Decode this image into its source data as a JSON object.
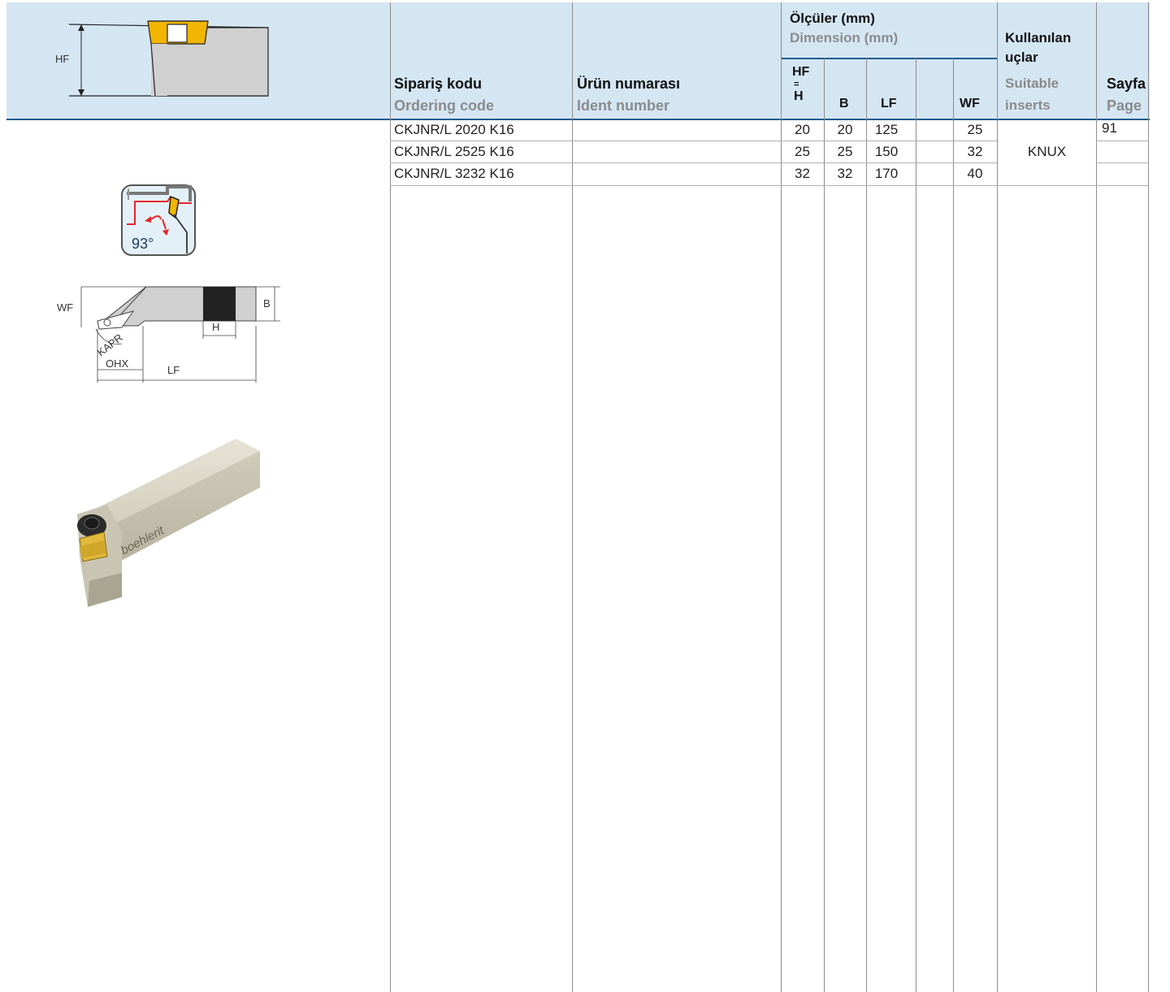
{
  "header": {
    "ordering_code_tr": "Sipariş kodu",
    "ordering_code_en": "Ordering code",
    "ident_number_tr": "Ürün numarası",
    "ident_number_en": "Ident number",
    "dimensions_tr": "Ölçüler (mm)",
    "dimensions_en": "Dimension (mm)",
    "inserts_tr_line1": "Kullanılan",
    "inserts_tr_line2": "uçlar",
    "inserts_en_line1": "Suitable",
    "inserts_en_line2": "inserts",
    "page_tr": "Sayfa",
    "page_en": "Page",
    "col_hf": "HF",
    "col_h": "H",
    "col_b": "B",
    "col_lf": "LF",
    "col_wf": "WF"
  },
  "diagram_labels": {
    "hf": "HF",
    "angle": "93°",
    "wf": "WF",
    "b": "B",
    "h": "H",
    "kapr": "KAPR",
    "ohx": "OHX",
    "lf": "LF",
    "brand": "boehlerit"
  },
  "rows": [
    {
      "code": "CKJNR/L 2020 K16",
      "ident": "",
      "hf": "20",
      "b": "20",
      "lf": "125",
      "extra": "",
      "wf": "25",
      "page": "91"
    },
    {
      "code": "CKJNR/L 2525 K16",
      "ident": "",
      "hf": "25",
      "b": "25",
      "lf": "150",
      "extra": "",
      "wf": "32",
      "page": ""
    },
    {
      "code": "CKJNR/L 3232 K16",
      "ident": "",
      "hf": "32",
      "b": "32",
      "lf": "170",
      "extra": "",
      "wf": "40",
      "page": ""
    }
  ],
  "inserts_value": "KNUX",
  "colors": {
    "header_bg": "#d5e6f3",
    "accent_blue": "#1c5c8e",
    "insert_yellow": "#f2b600",
    "highlight_red": "#e3262b"
  }
}
